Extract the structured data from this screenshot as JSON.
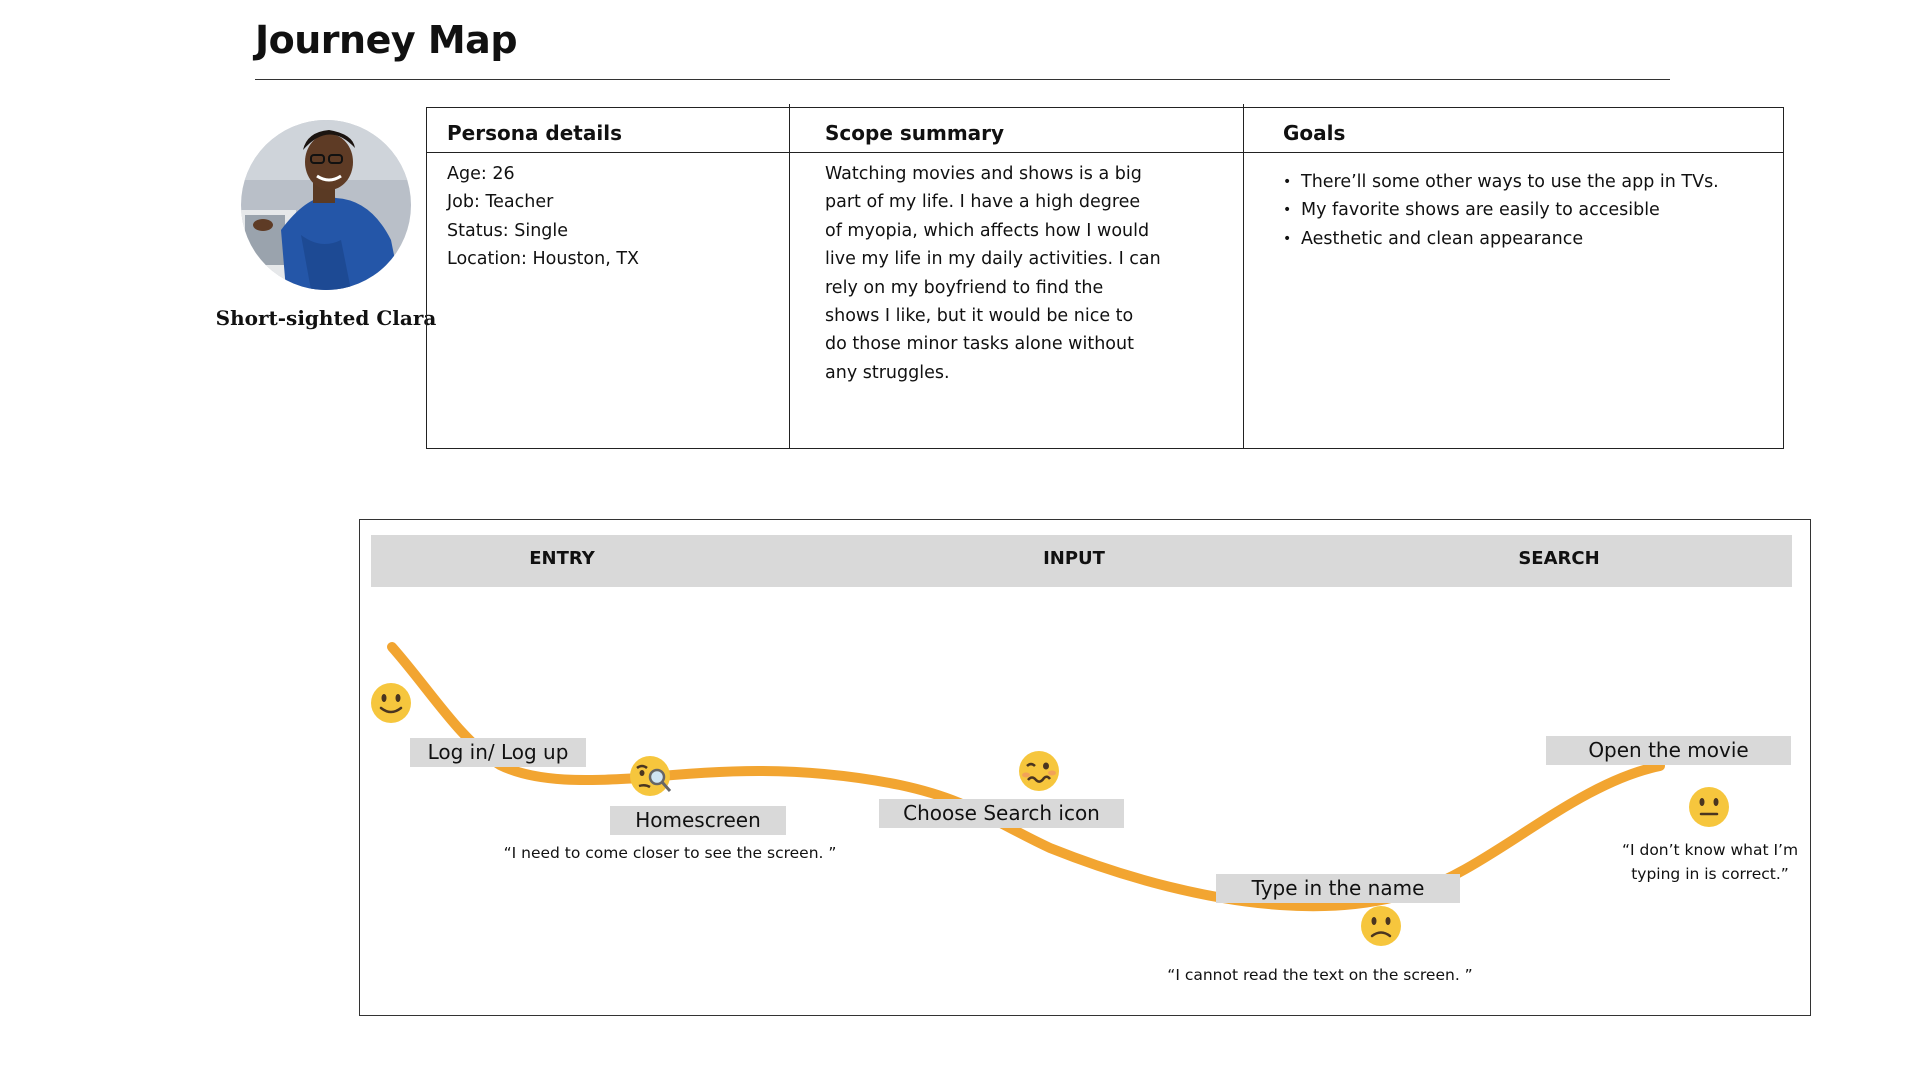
{
  "page": {
    "title": "Journey Map"
  },
  "persona": {
    "name": "Short-sighted Clara",
    "details_header": "Persona details",
    "details": [
      {
        "label": "Age: ",
        "value": "26"
      },
      {
        "label": "Job: ",
        "value": "Teacher"
      },
      {
        "label": "Status: ",
        "value": "Single"
      },
      {
        "label": "Location: ",
        "value": "Houston, TX"
      }
    ],
    "scope_header": "Scope summary",
    "scope_lines": [
      "Watching movies and shows is a big",
      "part of my life. I have a high degree",
      "of myopia, which affects how I would",
      "live my life in my daily activities. I can",
      "rely on my boyfriend to find the",
      "shows I like, but it would be nice to",
      "do those minor tasks alone without",
      "any struggles."
    ],
    "goals_header": "Goals",
    "goals": [
      "There’ll some other ways to use the app in TVs.",
      "My favorite shows are easily to accesible",
      "Aesthetic and clean appearance"
    ]
  },
  "journey": {
    "stages": [
      "ENTRY",
      "INPUT",
      "SEARCH"
    ],
    "steps": [
      {
        "label": "Log in/ Log up",
        "emotion": "smiling"
      },
      {
        "label": "Homescreen",
        "emotion": "squinting-with-magnifier"
      },
      {
        "label": "Choose Search icon",
        "emotion": "woozy"
      },
      {
        "label": "Type in the name",
        "emotion": "frowning"
      },
      {
        "label": "Open the movie",
        "emotion": "neutral"
      }
    ],
    "quotes": [
      "“I need to come closer to see the screen. ”",
      "“I cannot read the text on the screen. ”",
      "“I don’t know what I’m",
      "typing in is correct.”"
    ],
    "colors": {
      "curve": "#f2a531",
      "label_bg": "#d9d9d9",
      "emoji": "#f6c63d"
    }
  }
}
